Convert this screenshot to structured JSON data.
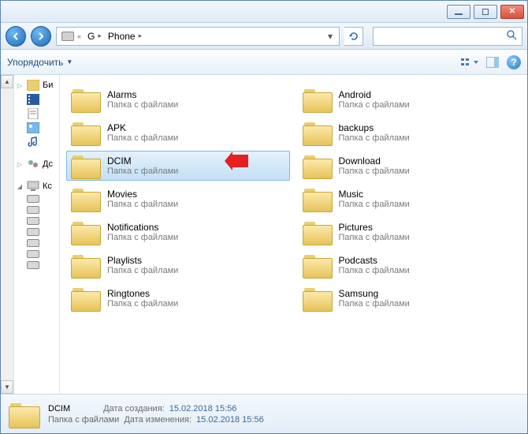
{
  "breadcrumb": {
    "drive": "G",
    "folder": "Phone"
  },
  "toolbar": {
    "organize": "Упорядочить"
  },
  "sidebar": {
    "items": [
      {
        "label": "Би"
      },
      {
        "label": ""
      },
      {
        "label": ""
      },
      {
        "label": ""
      },
      {
        "label": ""
      },
      {
        "label": ""
      },
      {
        "label": "Дс"
      },
      {
        "label": ""
      },
      {
        "label": "Кс"
      }
    ]
  },
  "folder_type": "Папка с файлами",
  "folders": [
    {
      "name": "Alarms"
    },
    {
      "name": "Android"
    },
    {
      "name": "APK"
    },
    {
      "name": "backups"
    },
    {
      "name": "DCIM",
      "selected": true
    },
    {
      "name": "Download"
    },
    {
      "name": "Movies"
    },
    {
      "name": "Music"
    },
    {
      "name": "Notifications"
    },
    {
      "name": "Pictures"
    },
    {
      "name": "Playlists"
    },
    {
      "name": "Podcasts"
    },
    {
      "name": "Ringtones"
    },
    {
      "name": "Samsung"
    }
  ],
  "status": {
    "name": "DCIM",
    "type": "Папка с файлами",
    "created_label": "Дата создания:",
    "created_value": "15.02.2018 15:56",
    "modified_label": "Дата изменения:",
    "modified_value": "15.02.2018 15:56"
  }
}
